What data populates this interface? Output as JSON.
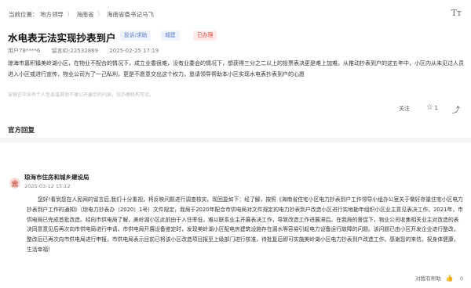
{
  "breadcrumb": {
    "prefix": "当前位置：",
    "items": [
      "地方领导",
      "海南省",
      "海南省委书记马飞"
    ],
    "separator": "〉"
  },
  "font_toggle_icon": "Tт",
  "post": {
    "title": "水电表无法实现抄表到户",
    "tags": [
      "投诉/求助",
      "城建",
      "已办理"
    ],
    "user": "用户78****6",
    "number": "留言ID:22532869",
    "date": "2025-02-25 17:19",
    "content": "琼海市嘉积镇美岭湖小区，在物业不配合的情况下，成立业委很难，没有业委会的情况下，想获得三分之二以上的投票表决更是难上加难。从推动抄表到户的这五年中，小区内从未见过人员进入小区或进行宣传，物业公司为了一己私利，更是不愿意交出这个权力。恳请领导帮助本小区实现水电表抄表到户的心愿",
    "disclaimer": "该留言中含有个人信息或其他不便公开展示的内容，仅办理机构可见。",
    "follow_label": "关注",
    "like_count": "1"
  },
  "reply_section": {
    "title": "官方回复"
  },
  "reply": {
    "org_name": "琼海市住房和城乡建设局",
    "time": "2025-03-12 15:12",
    "content": "您好!看到您在人民网的留言后,我们十分重视，将反映问题进行调查核实。现回复如下：经了解，按照《海南省住宅小区电力抄表到户工作领导小组办公室关于做好存量住宅小区电力抄表到户工作的通知》（琼电力抄表办〔2020〕1号）文件规定，我局于2020年配合市供电局对文件规定的电力抄表到户改造小区进行实地勘年组织小区业主意见表决工作。2021年，市供电局已完成首批改造。经向市供电局了解，美岭湖小区此前由于入住率低，难以联系业主开展表决工作，导致改造工作进展滞后。在我局的督促下，物业公司收集相关业主对改造的表决同意意见后再次向市供电局进行申请，市供电局开展设备鉴定时，发现美岭湖小区配电房建筑设施存在漏水等容易引起电力设备运行故障的问题。该问题已由小区开发企业进行整改，整改后已再次向市供电局进行申报，市供电局表示目前已将该小区改造项目报至上级部门进行核准，待批复后即可实施美岭湖小区电力抄表到户改造工作。感谢您的来信。祝身体健康，生活幸福!",
    "helpful_label": "对我有帮助",
    "helpful_count": "0"
  },
  "icons": {
    "star": "star-icon",
    "share": "share-icon",
    "org": "government-building-icon",
    "thumb": "thumbs-up-icon"
  },
  "colors": {
    "tag_blue_bg": "#eef2fb",
    "tag_blue_text": "#5b7ec8",
    "tag_red_bg": "#fdeceb",
    "tag_red_text": "#e2473f",
    "org_accent": "#c23b2e"
  }
}
